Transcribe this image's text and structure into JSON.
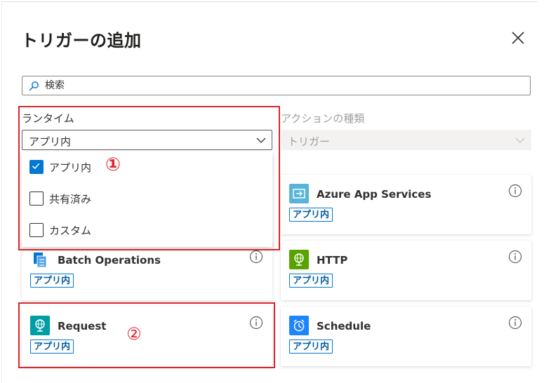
{
  "panel": {
    "title": "トリガーの追加"
  },
  "search": {
    "placeholder": "検索"
  },
  "runtime": {
    "label": "ランタイム",
    "selected": "アプリ内",
    "options": [
      {
        "label": "アプリ内",
        "checked": true
      },
      {
        "label": "共有済み",
        "checked": false
      },
      {
        "label": "カスタム",
        "checked": false
      }
    ]
  },
  "action_type": {
    "label": "アクションの種類",
    "selected": "トリガー"
  },
  "annotations": {
    "one": "①",
    "two": "②"
  },
  "cards": [
    {
      "name": "Azure App Services",
      "badge": "アプリ内",
      "icon": "app-service-icon",
      "color": "#59b4d9"
    },
    {
      "name": "Batch Operations",
      "badge": "アプリ内",
      "icon": "batch-icon",
      "color": "#0078d4"
    },
    {
      "name": "HTTP",
      "badge": "アプリ内",
      "icon": "globe-icon",
      "color": "#57a300"
    },
    {
      "name": "Request",
      "badge": "アプリ内",
      "icon": "request-globe-icon",
      "color": "#009da5"
    },
    {
      "name": "Schedule",
      "badge": "アプリ内",
      "icon": "alarm-clock-icon",
      "color": "#1f85ff"
    }
  ],
  "colors": {
    "accent": "#0078d4",
    "highlight": "#d9262a"
  }
}
